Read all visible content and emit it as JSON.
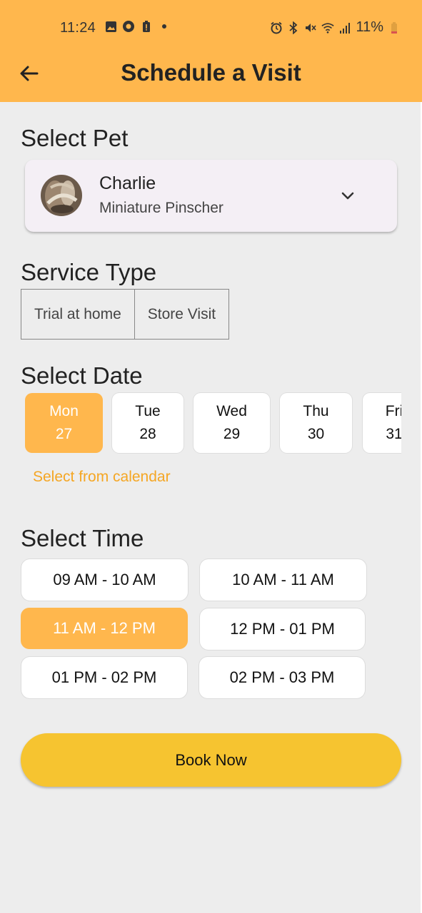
{
  "status_bar": {
    "time": "11:24",
    "battery": "11%"
  },
  "header": {
    "title": "Schedule a Visit"
  },
  "pet_section": {
    "label": "Select Pet",
    "selected_pet": {
      "name": "Charlie",
      "breed": "Miniature Pinscher"
    }
  },
  "service_section": {
    "label": "Service Type",
    "options": [
      "Trial at home",
      "Store Visit"
    ]
  },
  "date_section": {
    "label": "Select Date",
    "dates": [
      {
        "day": "Mon",
        "date": "27",
        "selected": true
      },
      {
        "day": "Tue",
        "date": "28",
        "selected": false
      },
      {
        "day": "Wed",
        "date": "29",
        "selected": false
      },
      {
        "day": "Thu",
        "date": "30",
        "selected": false
      },
      {
        "day": "Fri",
        "date": "31",
        "selected": false
      }
    ],
    "calendar_link": "Select from calendar"
  },
  "time_section": {
    "label": "Select Time",
    "slots": [
      {
        "label": "09 AM - 10 AM",
        "selected": false
      },
      {
        "label": "10 AM - 11 AM",
        "selected": false
      },
      {
        "label": "11 AM - 12 PM",
        "selected": true
      },
      {
        "label": "12 PM - 01 PM",
        "selected": false
      },
      {
        "label": "01 PM - 02 PM",
        "selected": false
      },
      {
        "label": "02 PM - 03 PM",
        "selected": false
      }
    ]
  },
  "book_button": "Book Now",
  "colors": {
    "app_bar": "#FFB74D",
    "selected": "#FFB74D",
    "link": "#F5A623",
    "book_button": "#F6C430",
    "background": "#EDEDED"
  }
}
